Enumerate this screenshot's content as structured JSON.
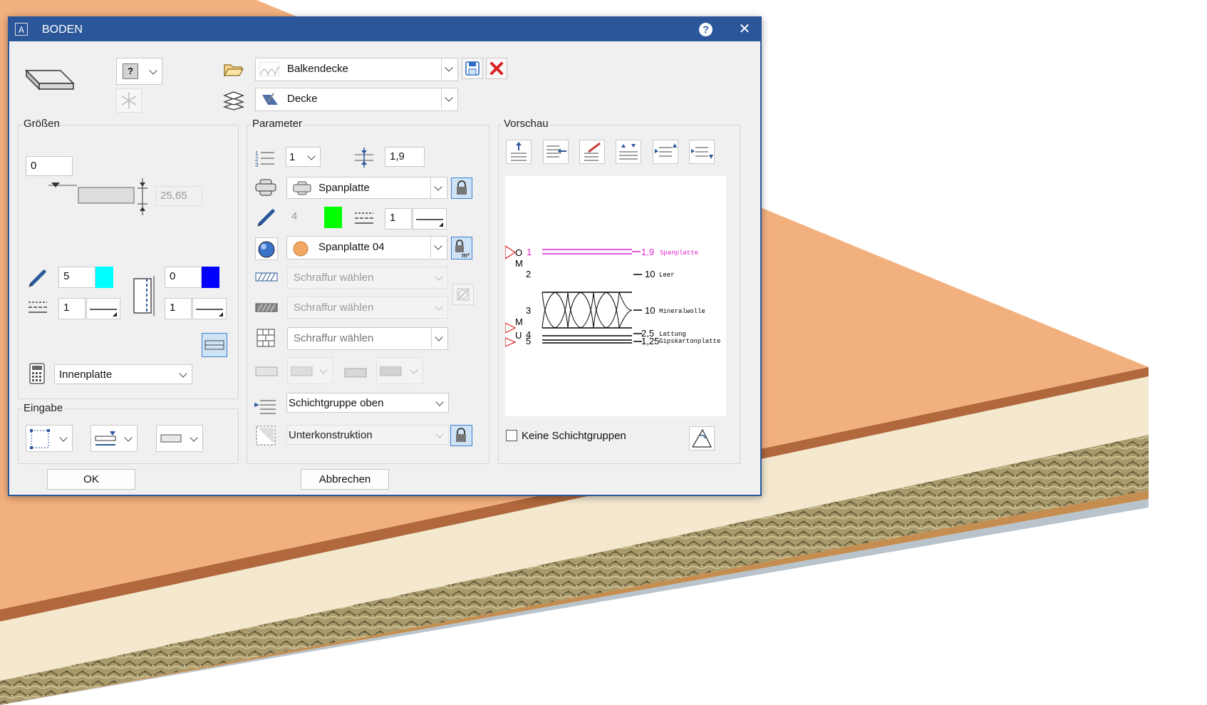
{
  "window": {
    "title": "BODEN",
    "help": "?",
    "close": "✕"
  },
  "top": {
    "profile_combo": "Balkendecke",
    "layer_combo": "Decke",
    "help_dropdown_glyph": "?"
  },
  "groesse": {
    "title": "Größen",
    "offset": "0",
    "thickness": "25,65",
    "pen_value": "5",
    "pen_color": "#00ffff",
    "linetype_value": "1",
    "right_pen_value": "0",
    "right_pen_color": "#0000ff",
    "right_linetype_value": "1",
    "element_type": "Innenplatte"
  },
  "eingabe": {
    "title": "Eingabe"
  },
  "parameter": {
    "title": "Parameter",
    "layer_number": "1",
    "layer_thickness": "1,9",
    "material_name": "Spanplatte",
    "pen_value": "4",
    "pen_color": "#00ff00",
    "linetype_value": "1",
    "surface_name": "Spanplatte 04",
    "hatch1": "Schraffur wählen",
    "hatch2": "Schraffur wählen",
    "hatch3": "Schraffur wählen",
    "layer_group": "Schichtgruppe oben",
    "substructure": "Unterkonstruktion"
  },
  "vorschau": {
    "title": "Vorschau",
    "checkbox_label": "Keine Schichtgruppen",
    "checkbox_checked": false,
    "layers": [
      {
        "index": "1",
        "value": "1,9",
        "name": "Spanplatte",
        "color": "#e020d0"
      },
      {
        "index": "2",
        "value": "10",
        "name": "Leer",
        "color": "#000000"
      },
      {
        "index": "3",
        "value": "10",
        "name": "Mineralwolle",
        "color": "#000000"
      },
      {
        "index": "4",
        "value": "2,5",
        "name": "Lattung",
        "color": "#000000"
      },
      {
        "index": "5",
        "value": "1,25",
        "name": "Gipskartonplatte",
        "color": "#000000"
      }
    ],
    "markers": {
      "o": "O",
      "m_top": "M",
      "m_bottom": "M",
      "u": "U"
    }
  },
  "buttons": {
    "ok": "OK",
    "cancel": "Abbrechen"
  },
  "colors": {
    "titlebar": "#2b579a",
    "accent": "#3d7fcf"
  }
}
